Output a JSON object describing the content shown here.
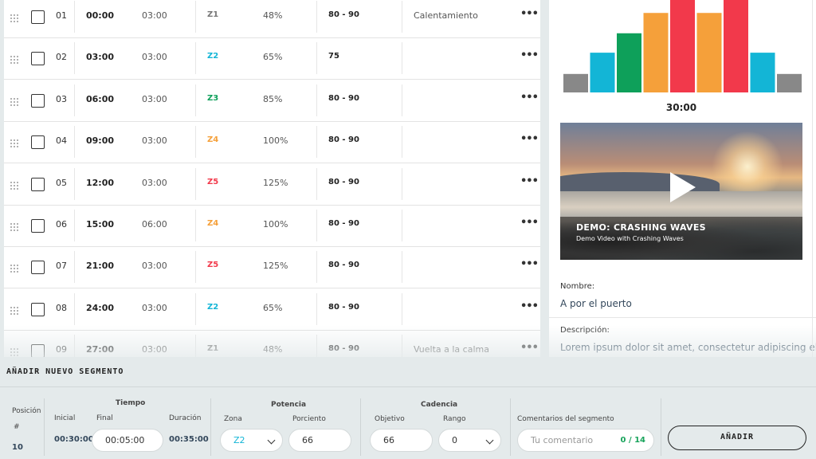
{
  "segments": [
    {
      "num": "01",
      "start": "00:00",
      "duration": "03:00",
      "zone": "Z1",
      "zone_color": "#777777",
      "percent": "48%",
      "cadence": "80 - 90",
      "comment": "Calentamiento"
    },
    {
      "num": "02",
      "start": "03:00",
      "duration": "03:00",
      "zone": "Z2",
      "zone_color": "#13b5d6",
      "percent": "65%",
      "cadence": "75",
      "comment": ""
    },
    {
      "num": "03",
      "start": "06:00",
      "duration": "03:00",
      "zone": "Z3",
      "zone_color": "#0ea05a",
      "percent": "85%",
      "cadence": "80 - 90",
      "comment": ""
    },
    {
      "num": "04",
      "start": "09:00",
      "duration": "03:00",
      "zone": "Z4",
      "zone_color": "#f5a03a",
      "percent": "100%",
      "cadence": "80 - 90",
      "comment": ""
    },
    {
      "num": "05",
      "start": "12:00",
      "duration": "03:00",
      "zone": "Z5",
      "zone_color": "#f2394b",
      "percent": "125%",
      "cadence": "80 - 90",
      "comment": ""
    },
    {
      "num": "06",
      "start": "15:00",
      "duration": "06:00",
      "zone": "Z4",
      "zone_color": "#f5a03a",
      "percent": "100%",
      "cadence": "80 - 90",
      "comment": ""
    },
    {
      "num": "07",
      "start": "21:00",
      "duration": "03:00",
      "zone": "Z5",
      "zone_color": "#f2394b",
      "percent": "125%",
      "cadence": "80 - 90",
      "comment": ""
    },
    {
      "num": "08",
      "start": "24:00",
      "duration": "03:00",
      "zone": "Z2",
      "zone_color": "#13b5d6",
      "percent": "65%",
      "cadence": "80 - 90",
      "comment": ""
    },
    {
      "num": "09",
      "start": "27:00",
      "duration": "03:00",
      "zone": "Z1",
      "zone_color": "#777777",
      "percent": "48%",
      "cadence": "80 - 90",
      "comment": "Vuelta a la calma"
    }
  ],
  "icons": {
    "drag_handle": "drag-handle-icon",
    "more": "more-icon",
    "play": "play-icon",
    "dropdown": "chevron-down-icon"
  },
  "chart_data": {
    "type": "bar",
    "bars": [
      {
        "zone": "Z1",
        "level": 0.2,
        "color": "#888888"
      },
      {
        "zone": "Z2",
        "level": 0.43,
        "color": "#13b5d6"
      },
      {
        "zone": "Z3",
        "level": 0.64,
        "color": "#0ea05a"
      },
      {
        "zone": "Z4",
        "level": 0.86,
        "color": "#f5a03a"
      },
      {
        "zone": "Z5",
        "level": 1.0,
        "color": "#f2394b"
      },
      {
        "zone": "Z4",
        "level": 0.86,
        "color": "#f5a03a"
      },
      {
        "zone": "Z5",
        "level": 1.0,
        "color": "#f2394b"
      },
      {
        "zone": "Z2",
        "level": 0.43,
        "color": "#13b5d6"
      },
      {
        "zone": "Z1",
        "level": 0.2,
        "color": "#888888"
      }
    ],
    "total": "30:00"
  },
  "video": {
    "title": "DEMO: CRASHING WAVES",
    "subtitle": "Demo Video with Crashing Waves"
  },
  "workout": {
    "name_label": "Nombre:",
    "name": "A por el puerto",
    "description_label": "Descripción:",
    "description": "Lorem ipsum dolor sit amet, consectetur adipiscing elit,"
  },
  "form": {
    "title": "AÑADIR NUEVO SEGMENTO",
    "position_label": "Posición",
    "position_hash": "#",
    "position_value": "10",
    "time_group": "Tiempo",
    "initial_label": "Inicial",
    "initial_value": "00:30:00",
    "final_label": "Final",
    "final_value": "00:05:00",
    "duration_label": "Duración",
    "duration_value": "00:35:00",
    "power_group": "Potencia",
    "zone_label": "Zona",
    "zone_value": "Z2",
    "percent_label": "Porciento",
    "percent_value": "66",
    "cadence_group": "Cadencia",
    "target_label": "Objetivo",
    "target_value": "66",
    "range_label": "Rango",
    "range_value": "0",
    "comments_label": "Comentarios del segmento",
    "comment_placeholder": "Tu comentario",
    "comment_counter": "0 / 14",
    "add_button": "AÑADIR"
  }
}
